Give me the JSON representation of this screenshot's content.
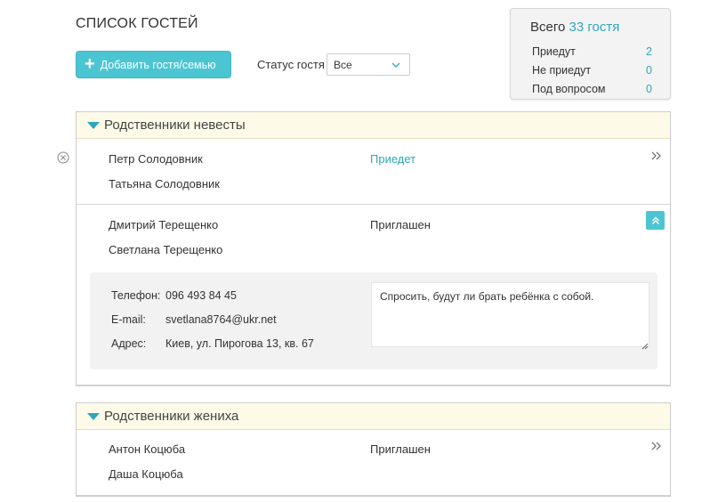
{
  "page": {
    "title": "СПИСОК ГОСТЕЙ"
  },
  "toolbar": {
    "add_label": "Добавить гостя/семью",
    "status_label": "Статус гостя",
    "status_value": "Все"
  },
  "summary": {
    "total_prefix": "Всего",
    "total_count": "33 гостя",
    "rows": [
      {
        "label": "Приедут",
        "value": "2"
      },
      {
        "label": "Не приедут",
        "value": "0"
      },
      {
        "label": "Под вопросом",
        "value": "0"
      }
    ]
  },
  "groups": [
    {
      "title": "Родственники невесты",
      "families": [
        {
          "members": [
            "Петр Солодовник",
            "Татьяна Солодовник"
          ],
          "status": "Приедет"
        },
        {
          "members": [
            "Дмитрий Терещенко",
            "Светлана Терещенко"
          ],
          "status": "Приглашен",
          "details": {
            "phone_label": "Телефон:",
            "phone": "096 493 84 45",
            "email_label": "E-mail:",
            "email": "svetlana8764@ukr.net",
            "address_label": "Адрес:",
            "address": "Киев, ул. Пирогова 13, кв. 67",
            "note": "Спросить, будут ли брать ребёнка с собой."
          }
        }
      ]
    },
    {
      "title": "Родственники жениха",
      "families": [
        {
          "members": [
            "Антон Коцюба",
            "Даша Коцюба"
          ],
          "status": "Приглашен"
        }
      ]
    }
  ],
  "colors": {
    "accent": "#4cc5d3",
    "accent_text": "#2ea7b8",
    "header_bg": "#fdfbe8",
    "panel_bg": "#f3f3f3"
  },
  "icons": {
    "delete": "circle-x-icon",
    "edit": "pencil-icon",
    "expand": "double-chevron-right-icon",
    "collapse": "double-chevron-up-icon",
    "dropdown": "chevron-down-icon",
    "add": "plus-icon",
    "group_toggle": "triangle-down-icon"
  }
}
